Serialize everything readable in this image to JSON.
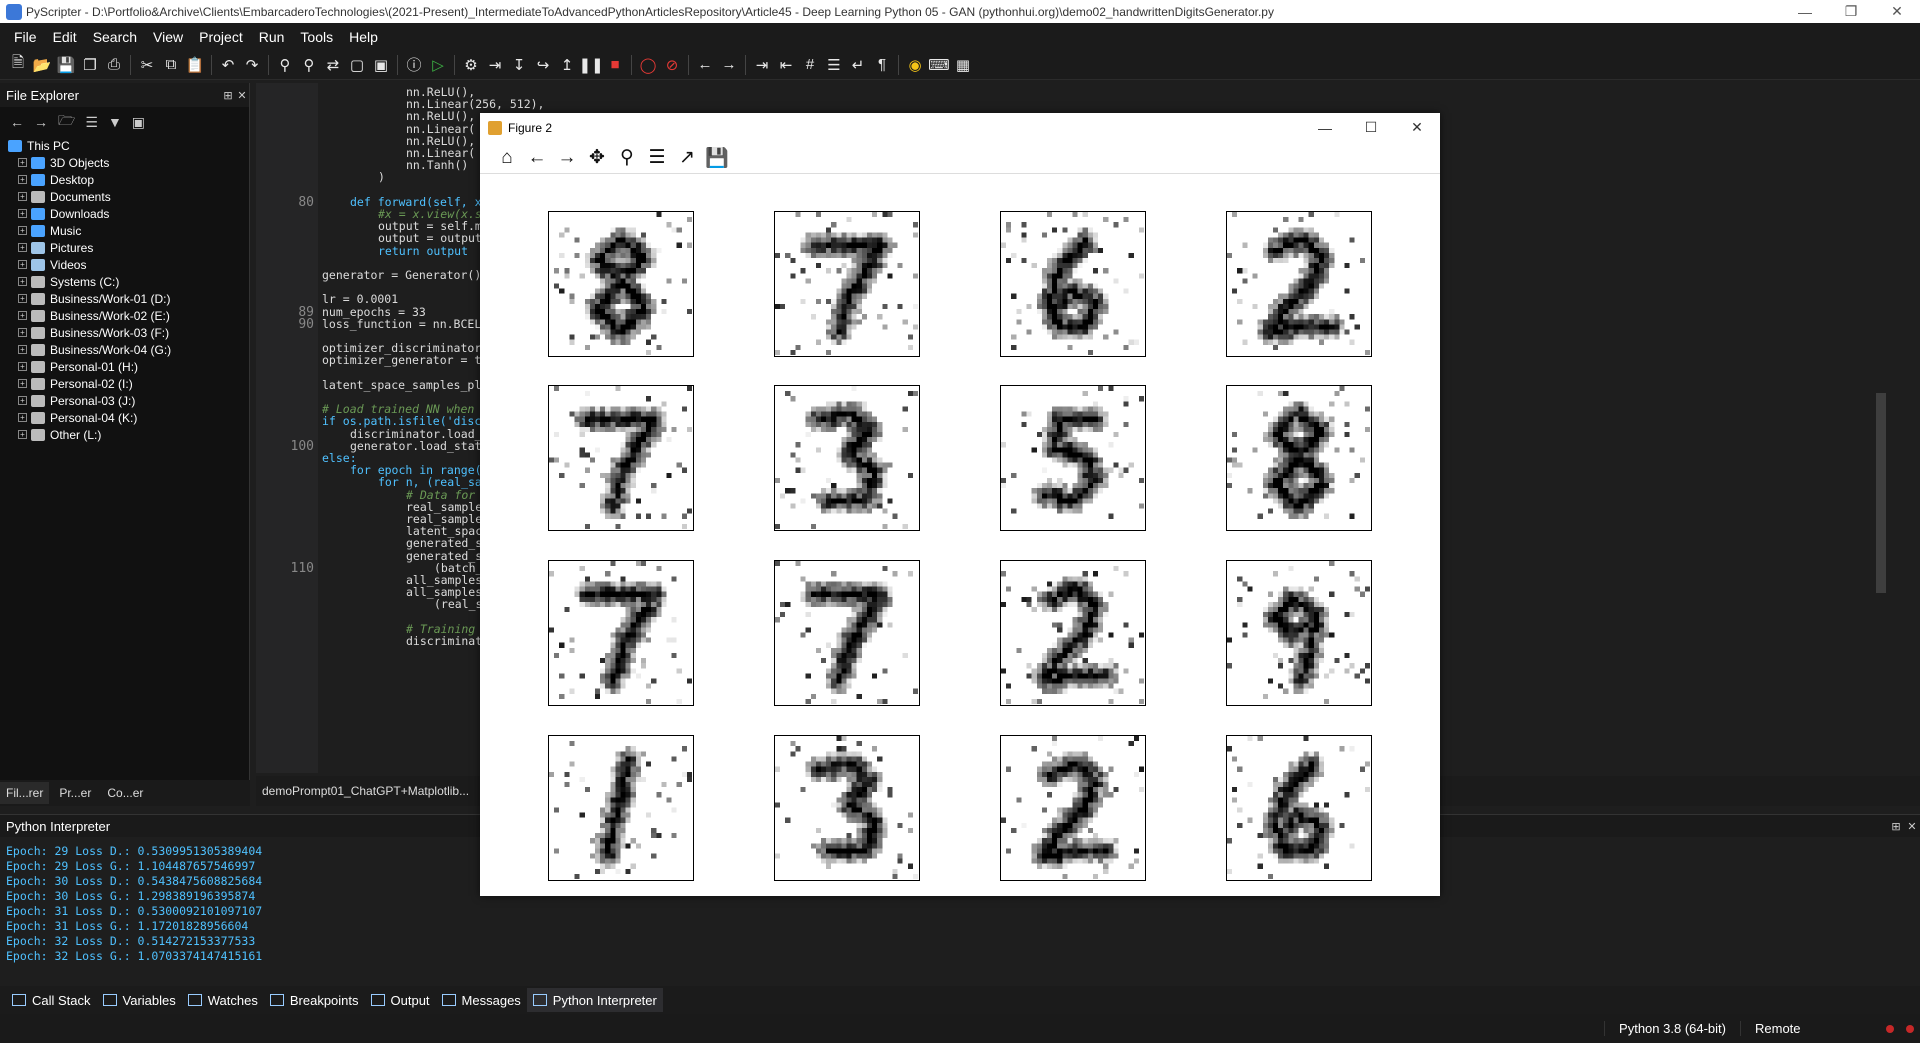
{
  "window": {
    "title": "PyScripter - D:\\Portfolio&Archive\\Clients\\EmbarcaderoTechnologies\\(2021-Present)_IntermediateToAdvancedPythonArticlesRepository\\Article45 - Deep Learning Python 05 - GAN (pythonhui.org)\\demo02_handwrittenDigitsGenerator.py"
  },
  "menu": [
    "File",
    "Edit",
    "Search",
    "View",
    "Project",
    "Run",
    "Tools",
    "Help"
  ],
  "file_explorer": {
    "title": "File Explorer",
    "root": "This PC",
    "items": [
      {
        "label": "3D Objects",
        "color": "#4aa3ff"
      },
      {
        "label": "Desktop",
        "color": "#4aa3ff"
      },
      {
        "label": "Documents",
        "color": "#bbbbbb"
      },
      {
        "label": "Downloads",
        "color": "#4aa3ff"
      },
      {
        "label": "Music",
        "color": "#4aa3ff"
      },
      {
        "label": "Pictures",
        "color": "#9ec5e8"
      },
      {
        "label": "Videos",
        "color": "#9ec5e8"
      },
      {
        "label": "Systems (C:)",
        "color": "#bbbbbb"
      },
      {
        "label": "Business/Work-01 (D:)",
        "color": "#bbbbbb"
      },
      {
        "label": "Business/Work-02 (E:)",
        "color": "#bbbbbb"
      },
      {
        "label": "Business/Work-03 (F:)",
        "color": "#bbbbbb"
      },
      {
        "label": "Business/Work-04 (G:)",
        "color": "#bbbbbb"
      },
      {
        "label": "Personal-01 (H:)",
        "color": "#bbbbbb"
      },
      {
        "label": "Personal-02 (I:)",
        "color": "#bbbbbb"
      },
      {
        "label": "Personal-03 (J:)",
        "color": "#bbbbbb"
      },
      {
        "label": "Personal-04 (K:)",
        "color": "#bbbbbb"
      },
      {
        "label": "Other (L:)",
        "color": "#bbbbbb"
      }
    ],
    "tabs": [
      "Fil...rer",
      "Pr...er",
      "Co...er"
    ]
  },
  "editor": {
    "line_numbers": [
      {
        "n": "80",
        "row": 9
      },
      {
        "n": "89",
        "row": 18
      },
      {
        "n": "90",
        "row": 19
      },
      {
        "n": "100",
        "row": 29
      },
      {
        "n": "110",
        "row": 39
      }
    ],
    "lines": [
      {
        "row": 0,
        "indent": 12,
        "text": "nn.ReLU(),",
        "cls": ""
      },
      {
        "row": 1,
        "indent": 12,
        "text": "nn.Linear(256, 512),",
        "cls": ""
      },
      {
        "row": 2,
        "indent": 12,
        "text": "nn.ReLU(),",
        "cls": ""
      },
      {
        "row": 3,
        "indent": 12,
        "text": "nn.Linear(",
        "cls": ""
      },
      {
        "row": 4,
        "indent": 12,
        "text": "nn.ReLU(),",
        "cls": ""
      },
      {
        "row": 5,
        "indent": 12,
        "text": "nn.Linear(",
        "cls": ""
      },
      {
        "row": 6,
        "indent": 12,
        "text": "nn.Tanh()",
        "cls": ""
      },
      {
        "row": 7,
        "indent": 8,
        "text": ")",
        "cls": ""
      },
      {
        "row": 9,
        "indent": 4,
        "text": "def forward(self, x",
        "cls": "kw"
      },
      {
        "row": 10,
        "indent": 8,
        "text": "#x = x.view(x.s",
        "cls": "cm"
      },
      {
        "row": 11,
        "indent": 8,
        "text": "output = self.m",
        "cls": ""
      },
      {
        "row": 12,
        "indent": 8,
        "text": "output = output",
        "cls": ""
      },
      {
        "row": 13,
        "indent": 8,
        "text": "return output",
        "cls": "kw"
      },
      {
        "row": 15,
        "indent": 0,
        "text": "generator = Generator()",
        "cls": ""
      },
      {
        "row": 17,
        "indent": 0,
        "text": "lr = 0.0001",
        "cls": ""
      },
      {
        "row": 18,
        "indent": 0,
        "text": "num_epochs = 33",
        "cls": ""
      },
      {
        "row": 19,
        "indent": 0,
        "text": "loss_function = nn.BCEL",
        "cls": ""
      },
      {
        "row": 21,
        "indent": 0,
        "text": "optimizer_discriminator",
        "cls": ""
      },
      {
        "row": 22,
        "indent": 0,
        "text": "optimizer_generator = t",
        "cls": ""
      },
      {
        "row": 24,
        "indent": 0,
        "text": "latent_space_samples_pl",
        "cls": ""
      },
      {
        "row": 26,
        "indent": 0,
        "text": "# Load trained NN when",
        "cls": "cm"
      },
      {
        "row": 27,
        "indent": 0,
        "text": "if os.path.isfile('disc",
        "cls": "kw"
      },
      {
        "row": 28,
        "indent": 4,
        "text": "discriminator.load_",
        "cls": ""
      },
      {
        "row": 29,
        "indent": 4,
        "text": "generator.load_stat",
        "cls": ""
      },
      {
        "row": 30,
        "indent": 0,
        "text": "else:",
        "cls": "kw"
      },
      {
        "row": 31,
        "indent": 4,
        "text": "for epoch in range(",
        "cls": "kw"
      },
      {
        "row": 32,
        "indent": 8,
        "text": "for n, (real_sa",
        "cls": "kw"
      },
      {
        "row": 33,
        "indent": 12,
        "text": "# Data for",
        "cls": "cm"
      },
      {
        "row": 34,
        "indent": 12,
        "text": "real_sample",
        "cls": ""
      },
      {
        "row": 35,
        "indent": 12,
        "text": "real_sample",
        "cls": ""
      },
      {
        "row": 36,
        "indent": 12,
        "text": "latent_spac",
        "cls": ""
      },
      {
        "row": 37,
        "indent": 12,
        "text": "generated_s",
        "cls": ""
      },
      {
        "row": 38,
        "indent": 12,
        "text": "generated_s",
        "cls": ""
      },
      {
        "row": 39,
        "indent": 16,
        "text": "(batch_",
        "cls": ""
      },
      {
        "row": 40,
        "indent": 12,
        "text": "all_samples",
        "cls": ""
      },
      {
        "row": 41,
        "indent": 12,
        "text": "all_samples",
        "cls": ""
      },
      {
        "row": 42,
        "indent": 16,
        "text": "(real_s",
        "cls": ""
      },
      {
        "row": 44,
        "indent": 12,
        "text": "# Training",
        "cls": "cm"
      },
      {
        "row": 45,
        "indent": 12,
        "text": "discriminat",
        "cls": ""
      }
    ],
    "tab_label": "demoPrompt01_ChatGPT+Matplotlib..."
  },
  "figure": {
    "title": "Figure 2",
    "tools": [
      "home-icon",
      "back-icon",
      "forward-icon",
      "pan-icon",
      "zoom-icon",
      "configure-icon",
      "edit-axes-icon",
      "save-icon"
    ],
    "digits": [
      "8",
      "7",
      "6",
      "2",
      "7",
      "3",
      "5",
      "8",
      "7",
      "7",
      "2",
      "9",
      "1",
      "3",
      "2",
      "6"
    ]
  },
  "interpreter": {
    "title": "Python Interpreter",
    "lines": [
      "Epoch: 29 Loss D.: 0.5309951305389404",
      "Epoch: 29 Loss G.: 1.104487657546997",
      "Epoch: 30 Loss D.: 0.5438475608825684",
      "Epoch: 30 Loss G.: 1.298389196395874",
      "Epoch: 31 Loss D.: 0.5300092101097107",
      "Epoch: 31 Loss G.: 1.17201828956604",
      "Epoch: 32 Loss D.: 0.514272153377533",
      "Epoch: 32 Loss G.: 1.0703374147415161"
    ]
  },
  "bottom_tabs": [
    "Call Stack",
    "Variables",
    "Watches",
    "Breakpoints",
    "Output",
    "Messages",
    "Python Interpreter"
  ],
  "status": {
    "python": "Python 3.8 (64-bit)",
    "remote": "Remote"
  }
}
